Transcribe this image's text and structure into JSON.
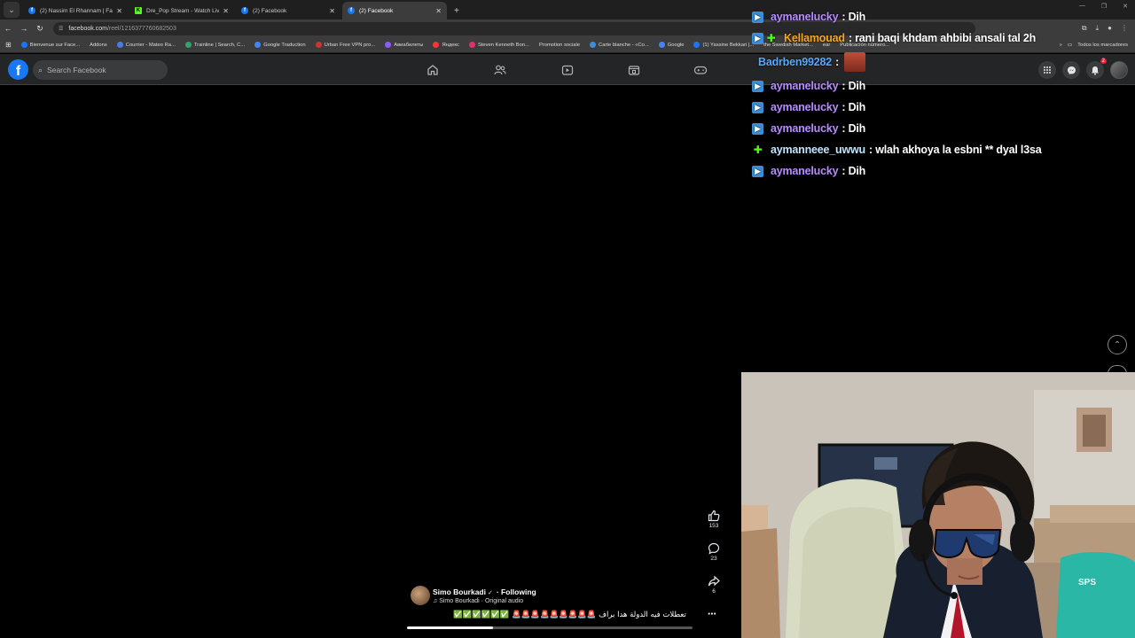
{
  "browser": {
    "tabs": [
      {
        "title": "(2) Nassim El Rhannam | Facebook",
        "icon": "facebook-icon",
        "active": false
      },
      {
        "title": "Dre_Pop Stream - Watch Live on Kick",
        "icon": "kick-icon",
        "active": false
      },
      {
        "title": "(2) Facebook",
        "icon": "facebook-icon",
        "active": false
      },
      {
        "title": "(2) Facebook",
        "icon": "facebook-icon",
        "active": true
      }
    ],
    "new_tab": "+",
    "url_host": "facebook.com",
    "url_path": "/reel/1216377760682503",
    "bookmarks": [
      "Bienvenue sur Face...",
      "Addons",
      "Courrier - Mateo Ra...",
      "Trainline | Search, C...",
      "Google Traduction",
      "Urban Free VPN pro...",
      "Авиабилеты",
      "Яндекс",
      "Steven Kenneth Bon...",
      "Promotion sociale",
      "Carte blanche - «Co...",
      "Google",
      "(1) Yassine Bekkari |...",
      "the Swedish Market...",
      "ear",
      "Publicación número..."
    ],
    "all_bookmarks": "Todos los marcadores"
  },
  "facebook": {
    "search_placeholder": "Search Facebook",
    "notifications_count": "2",
    "brand_color": "#1877f2"
  },
  "chat": [
    {
      "user": "aymanelucky",
      "text": ": Dih",
      "color": "#b68cff",
      "badge": "blue"
    },
    {
      "user": "Kellamouad",
      "text": ": rani baqi khdam ahbibi ansali tal 2h",
      "color": "#f5a623",
      "badge": "blue-green"
    },
    {
      "user": "Badrben99282",
      "text": ":",
      "color": "#5aa7ff",
      "badge": "none",
      "emote": true
    },
    {
      "user": "aymanelucky",
      "text": ": Dih",
      "color": "#b68cff",
      "badge": "blue"
    },
    {
      "user": "aymanelucky",
      "text": ": Dih",
      "color": "#b68cff",
      "badge": "blue"
    },
    {
      "user": "aymanelucky",
      "text": ": Dih",
      "color": "#b68cff",
      "badge": "blue"
    },
    {
      "user": "aymanneee_uwwu",
      "text": ": wlah akhoya la esbni ** dyal l3sa",
      "color": "#bfe6ff",
      "badge": "green"
    },
    {
      "user": "aymanelucky",
      "text": ": Dih",
      "color": "#b68cff",
      "badge": "blue"
    }
  ],
  "reel": {
    "author": "Simo Bourkadi",
    "follow_state": "· Following",
    "audio": "Simo Bourkadi · Original audio",
    "caption": "تعطلات فيه الدولة هدا براف 🚨🚨🚨🚨🚨🚨🚨🚨🚨 ✅✅✅✅✅✅",
    "likes": "153",
    "comments": "23",
    "shares": "6",
    "progress": 0.3
  }
}
